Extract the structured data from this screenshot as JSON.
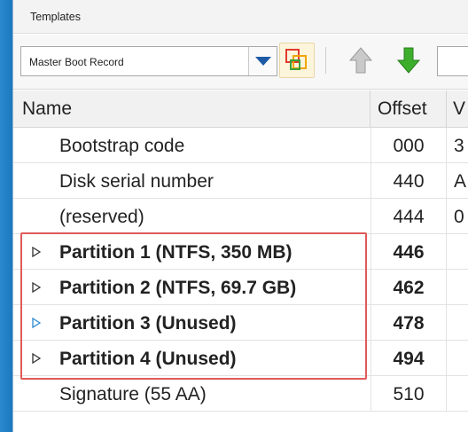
{
  "panel": {
    "title": "Templates"
  },
  "toolbar": {
    "template_select": {
      "value": "Master Boot Record"
    },
    "buttons": [
      {
        "name": "view-icon"
      },
      {
        "name": "arrow-up-icon"
      },
      {
        "name": "arrow-down-icon"
      }
    ]
  },
  "grid": {
    "columns": [
      "Name",
      "Offset",
      "V"
    ],
    "rows": [
      {
        "name": "Bootstrap code",
        "offset": "000",
        "value": "3",
        "bold": false,
        "expander": "none"
      },
      {
        "name": "Disk serial number",
        "offset": "440",
        "value": "A",
        "bold": false,
        "expander": "none"
      },
      {
        "name": "(reserved)",
        "offset": "444",
        "value": "0",
        "bold": false,
        "expander": "none"
      },
      {
        "name": "Partition 1 (NTFS, 350 MB)",
        "offset": "446",
        "value": "",
        "bold": true,
        "expander": "collapsed"
      },
      {
        "name": "Partition 2 (NTFS, 69.7 GB)",
        "offset": "462",
        "value": "",
        "bold": true,
        "expander": "collapsed"
      },
      {
        "name": "Partition 3 (Unused)",
        "offset": "478",
        "value": "",
        "bold": true,
        "expander": "hover"
      },
      {
        "name": "Partition 4 (Unused)",
        "offset": "494",
        "value": "",
        "bold": true,
        "expander": "collapsed"
      },
      {
        "name": "Signature (55 AA)",
        "offset": "510",
        "value": "",
        "bold": false,
        "expander": "none"
      }
    ]
  },
  "colors": {
    "highlight_border": "#e05a5a",
    "expander_hover": "#2a8ad0",
    "arrow_down": "#3cae2c",
    "combo_arrow": "#1c5aa6"
  }
}
